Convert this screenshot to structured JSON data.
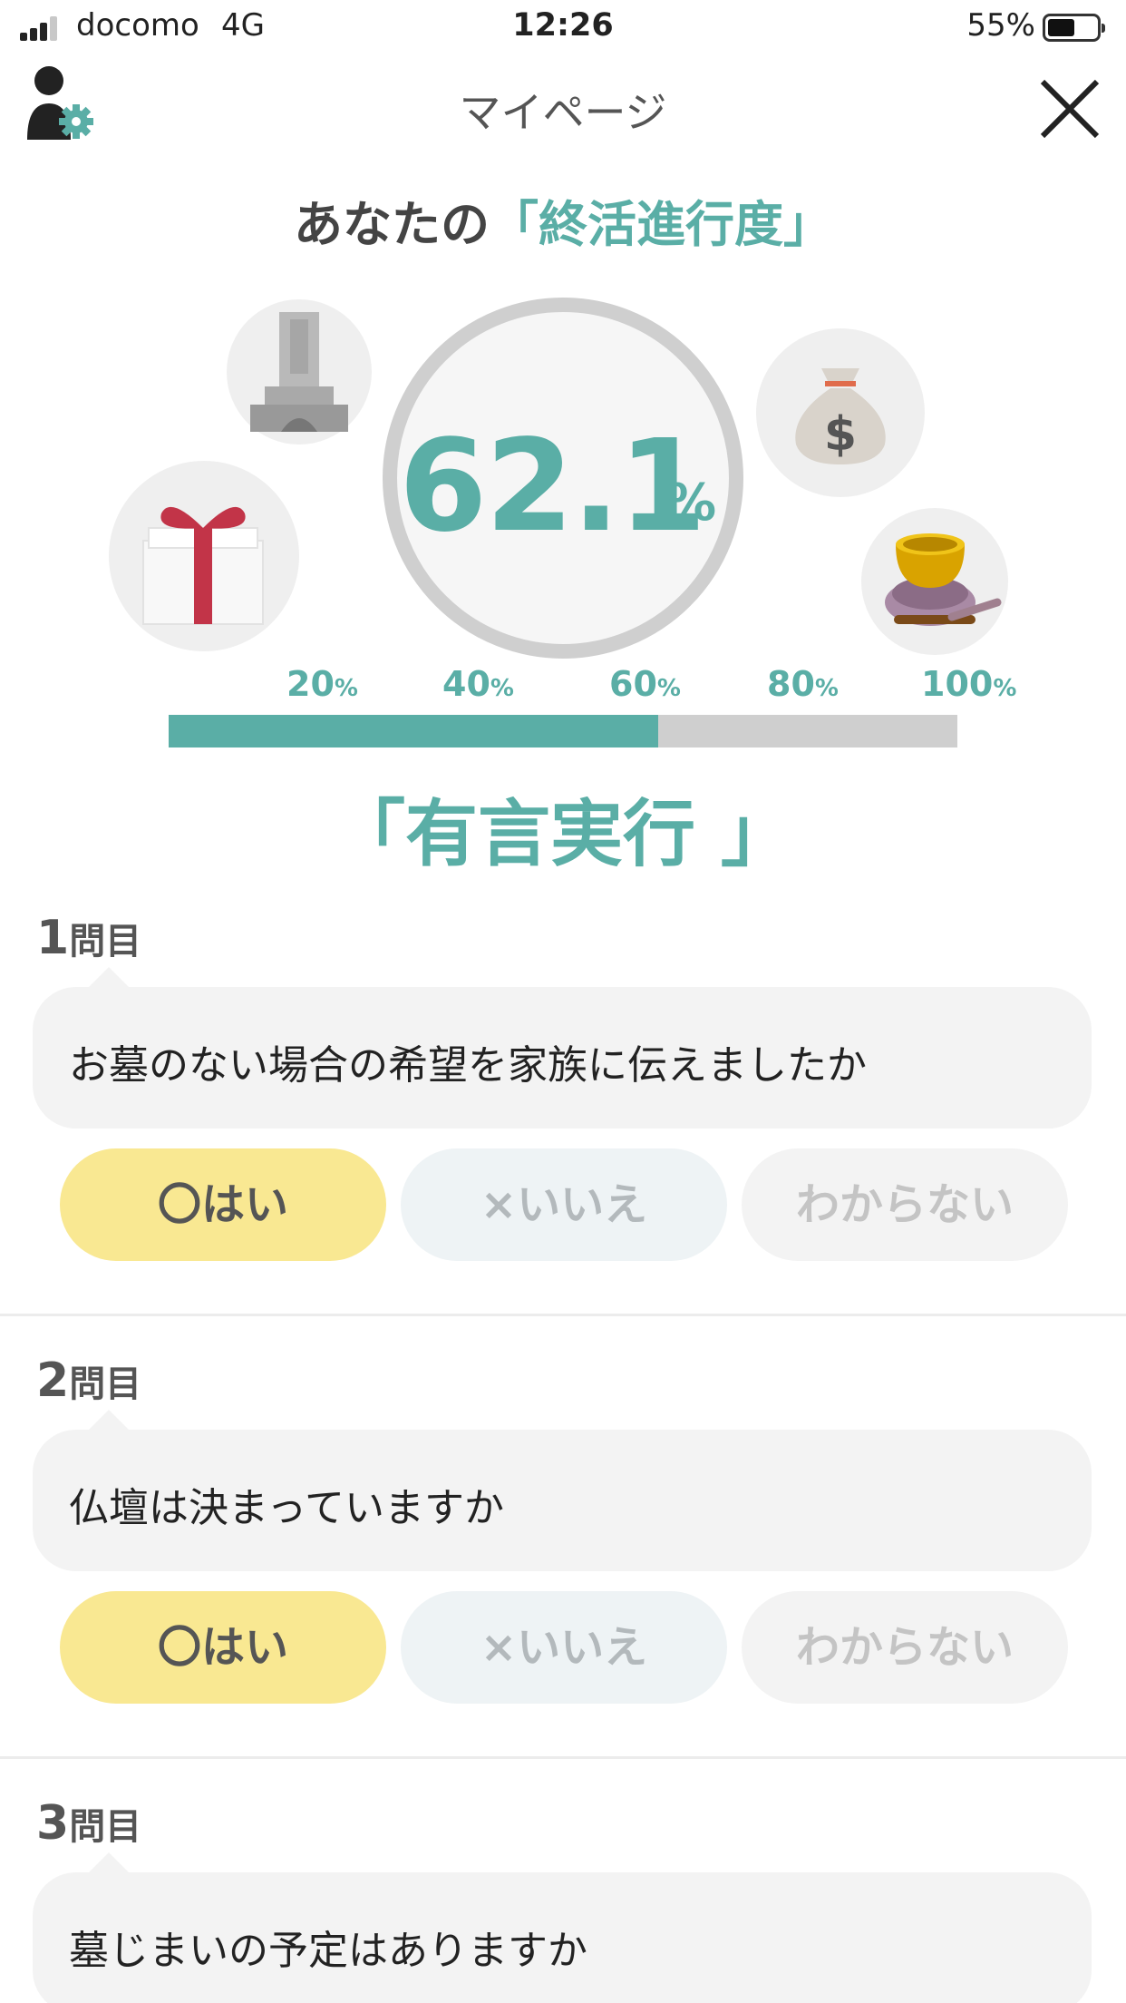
{
  "status": {
    "carrier": "docomo",
    "network": "4G",
    "time": "12:26",
    "battery_text": "55%",
    "battery_level": 0.55,
    "signal_bars": 3
  },
  "header": {
    "title": "マイページ",
    "profile_icon": "user-settings-icon",
    "close_icon": "close-icon"
  },
  "headline": {
    "prefix": "あなたの",
    "accent": "「終活進行度」",
    "accent_color": "#5aaea6"
  },
  "gauge": {
    "value": "62.1",
    "unit": "%"
  },
  "illustrations": [
    "grave-icon",
    "gift-icon",
    "money-bag-icon",
    "singing-bowl-icon"
  ],
  "progress": {
    "ticks": [
      {
        "num": "20",
        "unit": "%"
      },
      {
        "num": "40",
        "unit": "%"
      },
      {
        "num": "60",
        "unit": "%"
      },
      {
        "num": "80",
        "unit": "%"
      },
      {
        "num": "100",
        "unit": "%"
      }
    ],
    "fraction": 0.621,
    "rank_label": "「有言実行 」"
  },
  "questions": [
    {
      "num": "1",
      "label": "問目",
      "text": "お墓のない場合の希望を家族に伝えましたか",
      "yes": "〇はい",
      "no": "×いいえ",
      "unknown": "わからない"
    },
    {
      "num": "2",
      "label": "問目",
      "text": "仏壇は決まっていますか",
      "yes": "〇はい",
      "no": "×いいえ",
      "unknown": "わからない"
    },
    {
      "num": "3",
      "label": "問目",
      "text": "墓じまいの予定はありますか"
    }
  ],
  "colors": {
    "accent": "#5aaea6",
    "yes_button": "#f9e892",
    "no_button": "#eef3f5",
    "unknown_button": "#f3f3f3"
  }
}
